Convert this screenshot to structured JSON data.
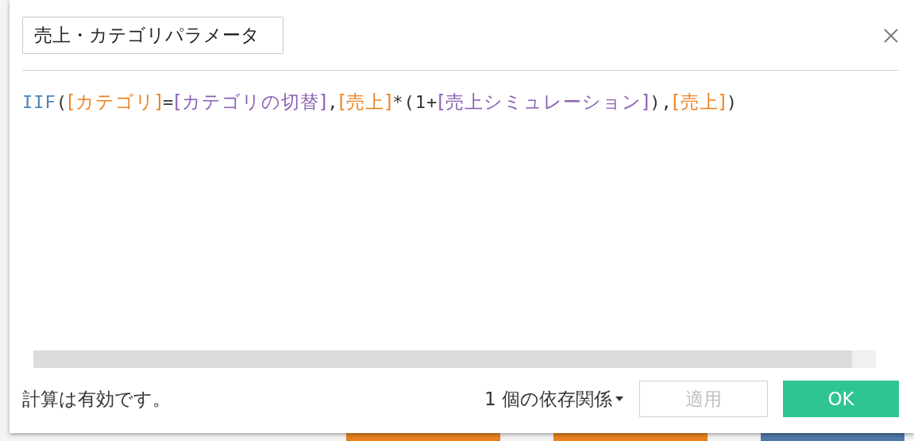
{
  "dialog": {
    "name_field": {
      "value": "売上・カテゴリパラメータ"
    },
    "formula": [
      {
        "kind": "function",
        "text": "IIF"
      },
      {
        "kind": "punct",
        "text": "("
      },
      {
        "kind": "field",
        "text": "[カテゴリ]"
      },
      {
        "kind": "punct",
        "text": "="
      },
      {
        "kind": "parameter",
        "text": "[カテゴリの切替]"
      },
      {
        "kind": "punct",
        "text": ","
      },
      {
        "kind": "field",
        "text": "[売上]"
      },
      {
        "kind": "punct",
        "text": "*"
      },
      {
        "kind": "punct",
        "text": "(1+"
      },
      {
        "kind": "parameter",
        "text": "[売上シミュレーション]"
      },
      {
        "kind": "punct",
        "text": ")"
      },
      {
        "kind": "punct",
        "text": ","
      },
      {
        "kind": "field",
        "text": "[売上]"
      },
      {
        "kind": "punct",
        "text": ")"
      }
    ],
    "status": "計算は有効です。",
    "dependencies": "1 個の依存関係",
    "buttons": [
      {
        "kind": "secondary",
        "label": "適用",
        "disabled": true
      },
      {
        "kind": "primary",
        "label": "OK",
        "disabled": false
      }
    ]
  }
}
